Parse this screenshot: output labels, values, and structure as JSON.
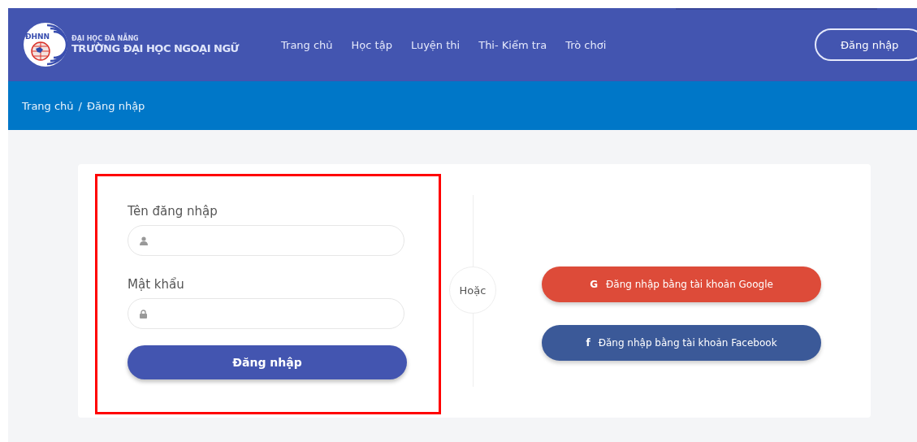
{
  "header": {
    "logo": {
      "badge": "ĐHNN",
      "org": "ĐẠI HỌC ĐÀ NẴNG",
      "school": "TRƯỜNG ĐẠI HỌC NGOẠI NGỮ"
    },
    "nav": [
      {
        "label": "Trang chủ"
      },
      {
        "label": "Học tập"
      },
      {
        "label": "Luyện thi"
      },
      {
        "label": "Thi- Kiểm tra"
      },
      {
        "label": "Trò chơi"
      }
    ],
    "login_button": "Đăng nhập"
  },
  "breadcrumb": {
    "items": [
      "Trang chủ",
      "Đăng nhập"
    ],
    "separator": "/"
  },
  "login_form": {
    "fields": [
      {
        "label": "Tên đăng nhập",
        "kind": "user"
      },
      {
        "label": "Mật khẩu",
        "kind": "lock"
      }
    ],
    "submit": "Đăng nhập",
    "highlighted": true
  },
  "divider": "Hoặc",
  "social_buttons": [
    {
      "kind": "google",
      "glyph": "G",
      "label": "Đăng nhập bằng tài khoản Google"
    },
    {
      "kind": "facebook",
      "glyph": "f",
      "label": "Đăng nhập bằng tài khoản Facebook"
    }
  ]
}
